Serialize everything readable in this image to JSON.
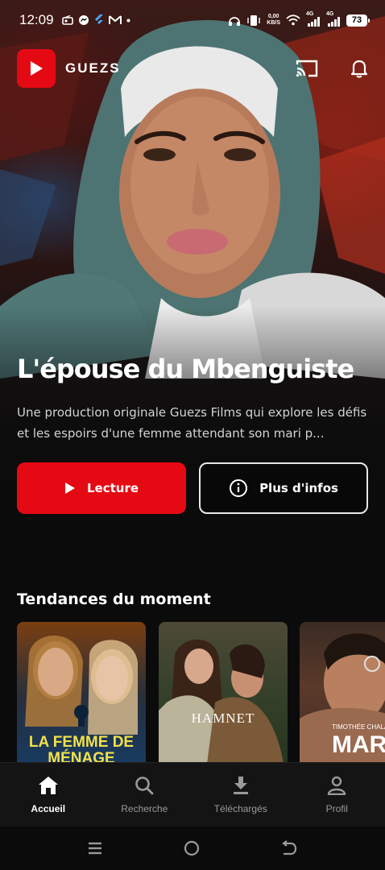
{
  "status_bar": {
    "time": "12:09",
    "network_speed_value": "0,00",
    "network_speed_unit": "KB/S",
    "battery": "73",
    "signal_1": "4G",
    "signal_2": "4G"
  },
  "header": {
    "brand": "GUEZS"
  },
  "hero": {
    "title": "L'épouse du Mbenguiste",
    "description": "Une production originale Guezs Films qui explore les défis et les espoirs d'une femme attendant son mari p...",
    "play_label": "Lecture",
    "info_label": "Plus d'infos"
  },
  "trending": {
    "title": "Tendances du moment",
    "posters": [
      {
        "text": "LA FEMME DE MÉNAGE"
      },
      {
        "text": "HAMNET"
      },
      {
        "text": "MARTY",
        "caption": "TIMOTHÉE CHALAMET"
      }
    ]
  },
  "bottom_nav": [
    {
      "label": "Accueil",
      "icon": "home-icon",
      "active": true
    },
    {
      "label": "Recherche",
      "icon": "search-icon",
      "active": false
    },
    {
      "label": "Téléchargés",
      "icon": "download-icon",
      "active": false
    },
    {
      "label": "Profil",
      "icon": "person-icon",
      "active": false
    }
  ],
  "colors": {
    "accent": "#e50914",
    "background": "#0b0b0b",
    "nav_background": "#141414"
  }
}
